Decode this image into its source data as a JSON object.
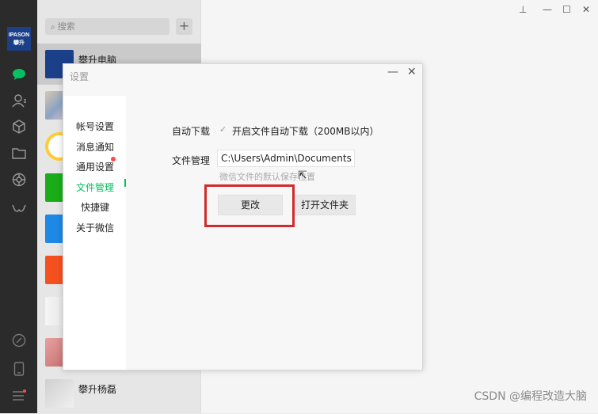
{
  "nav": {
    "logo_top": "IPASON",
    "logo_bottom": "攀升",
    "icons": [
      "chat-icon",
      "contacts-icon",
      "favorites-icon",
      "folder-icon",
      "moments-icon",
      "mini-program-icon",
      "link-icon",
      "phone-icon",
      "menu-icon"
    ],
    "chat_active_color": "#07c160"
  },
  "search": {
    "placeholder": "搜索",
    "add_label": "+"
  },
  "contacts": [
    {
      "name": "攀升电脑"
    },
    {
      "name": "攀升杨磊"
    }
  ],
  "window": {
    "pin": "⊥",
    "min": "—",
    "max": "☐",
    "close": "✕"
  },
  "dialog": {
    "title": "设置",
    "min": "—",
    "close": "✕",
    "menu": [
      "帐号设置",
      "消息通知",
      "通用设置",
      "文件管理",
      "快捷键",
      "关于微信"
    ],
    "active_index": 3,
    "auto_download_label": "自动下载",
    "auto_download_option": "开启文件自动下载（200MB以内）",
    "file_manage_label": "文件管理",
    "path": "C:\\Users\\Admin\\Documents",
    "hint": "微信文件的默认保存位置",
    "change_button": "更改",
    "open_folder_button": "打开文件夹"
  },
  "watermark": "CSDN @编程改造大脑"
}
